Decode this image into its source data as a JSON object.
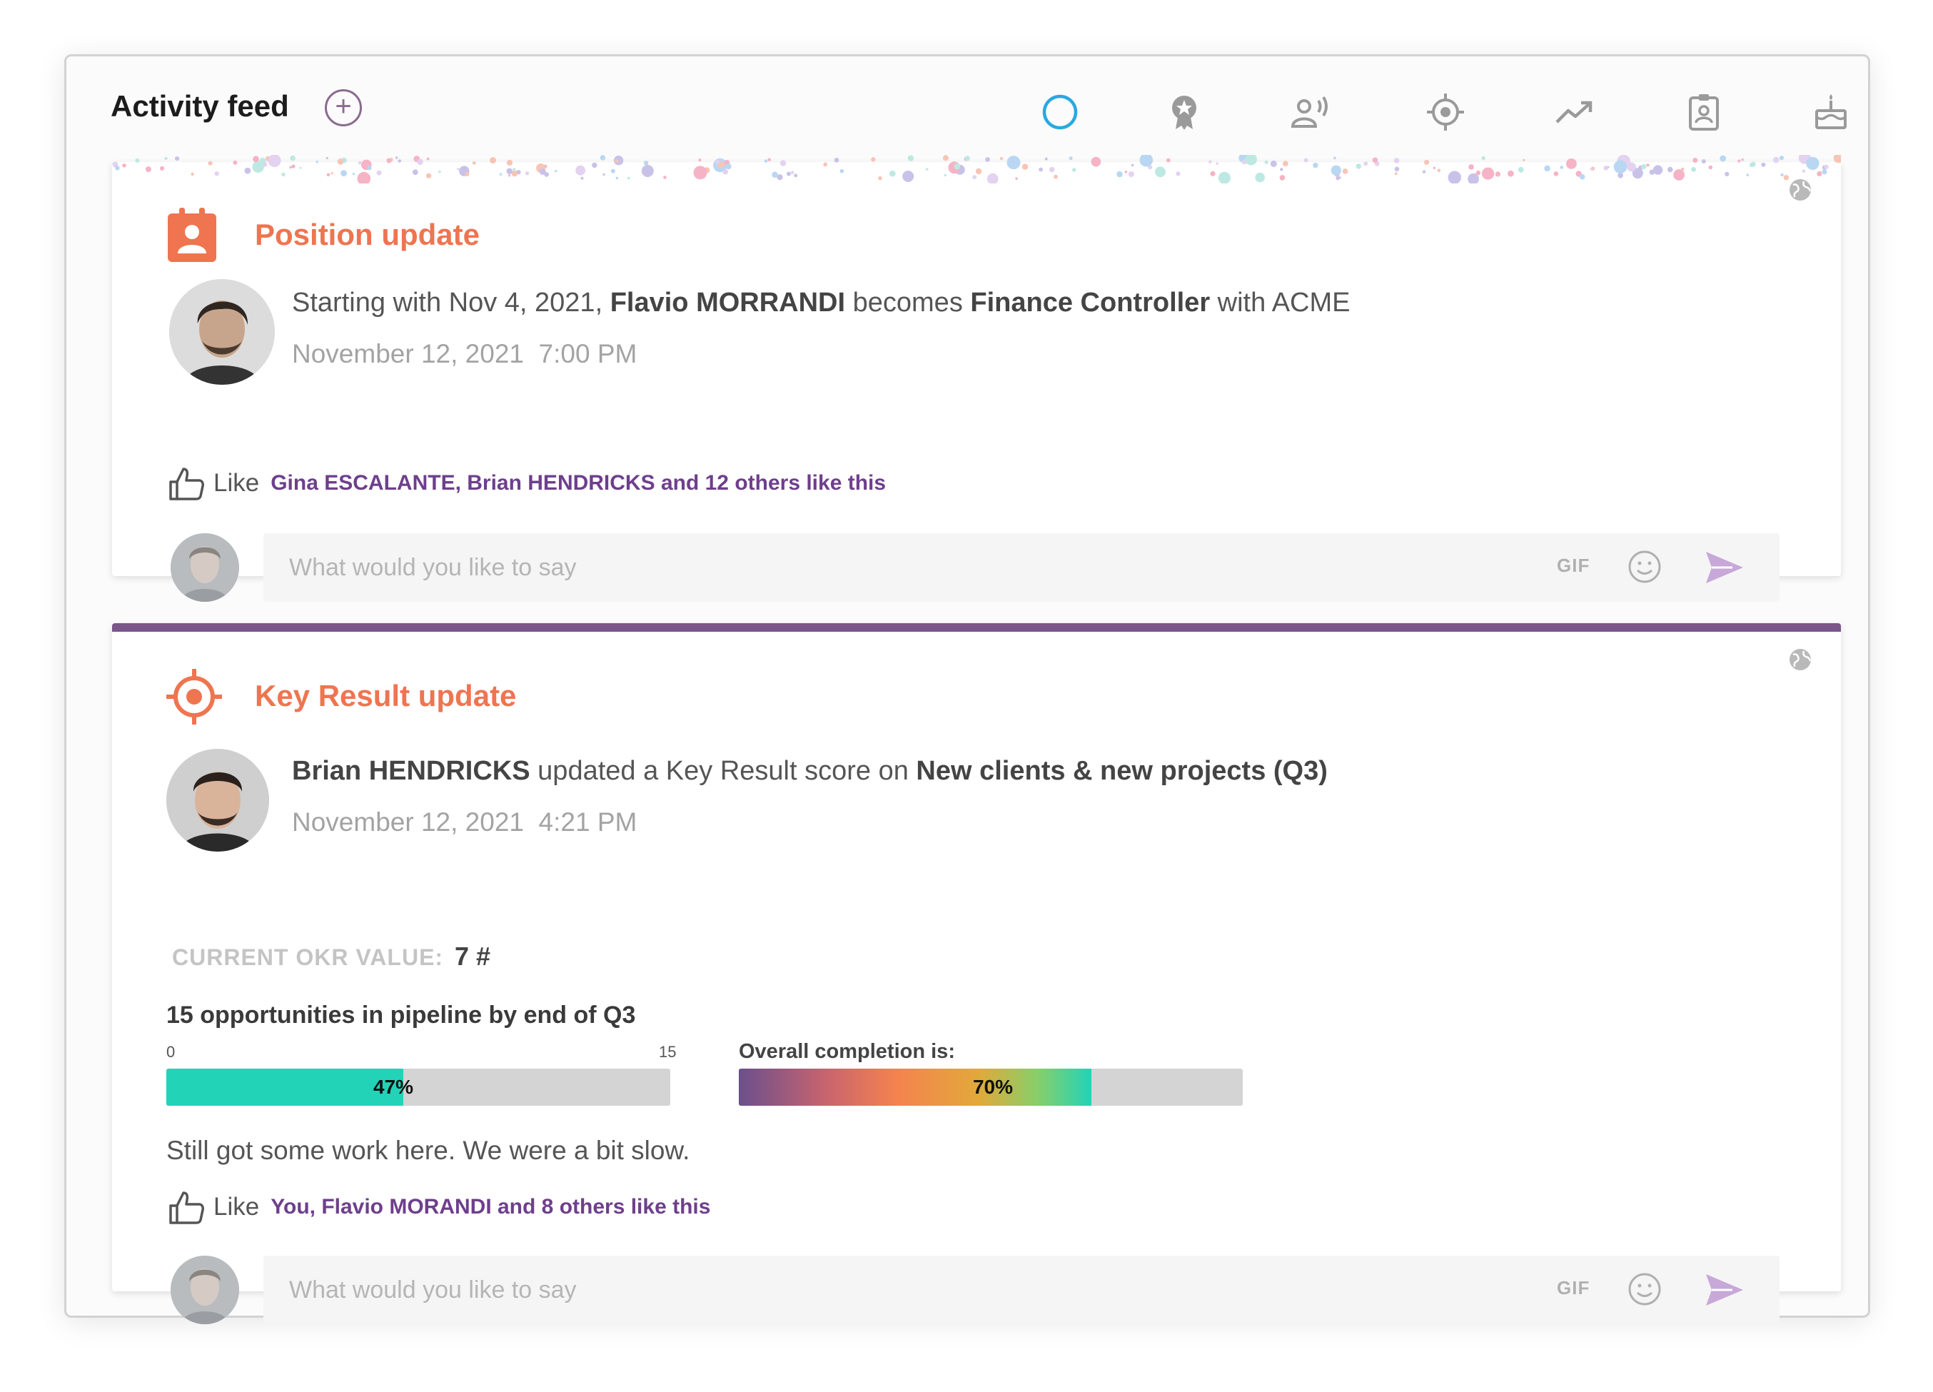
{
  "header": {
    "title": "Activity feed",
    "filters": [
      {
        "name": "all-activity",
        "icon": "circle-icon",
        "active": true
      },
      {
        "name": "recognition",
        "icon": "award-icon"
      },
      {
        "name": "announcements",
        "icon": "speaking-person-icon"
      },
      {
        "name": "objectives",
        "icon": "target-icon"
      },
      {
        "name": "trends",
        "icon": "trending-up-icon"
      },
      {
        "name": "position",
        "icon": "id-badge-icon"
      },
      {
        "name": "birthdays",
        "icon": "cake-icon"
      }
    ]
  },
  "colors": {
    "accent_orange": "#ee7550",
    "accent_purple": "#6e3f8c",
    "card_border_purple": "#7a568a",
    "progress_teal": "#22d3b8",
    "active_filter_blue": "#2aa8e0"
  },
  "cards": [
    {
      "type": "position_update",
      "title": "Position update",
      "text_prefix": "Starting with Nov 4, 2021,",
      "person": "Flavio MORRANDI",
      "verb": "becomes",
      "role": "Finance Controller",
      "suffix": "with ACME",
      "date": "November 12, 2021",
      "time": "7:00 PM",
      "like_label": "Like",
      "likes_text": "Gina ESCALANTE, Brian HENDRICKS and 12 others like this",
      "comment_placeholder": "What would you like to say",
      "gif_label": "GIF"
    },
    {
      "type": "key_result_update",
      "title": "Key Result update",
      "person": "Brian HENDRICKS",
      "verb": "updated a Key Result score on",
      "objective": "New clients & new projects (Q3)",
      "date": "November 12, 2021",
      "time": "4:21 PM",
      "okr_label": "CURRENT OKR VALUE:",
      "okr_value": "7 #",
      "kr_name": "15 opportunities in pipeline by end of Q3",
      "range_min": "0",
      "range_max": "15",
      "progress": 0.47,
      "progress_label": "47%",
      "overall_label": "Overall completion is:",
      "overall": 0.7,
      "overall_text": "70%",
      "note": "Still got some work here. We were a bit slow.",
      "like_label": "Like",
      "likes_text": "You, Flavio MORANDI and 8 others like this",
      "comment_placeholder": "What would you like to say",
      "gif_label": "GIF"
    }
  ]
}
